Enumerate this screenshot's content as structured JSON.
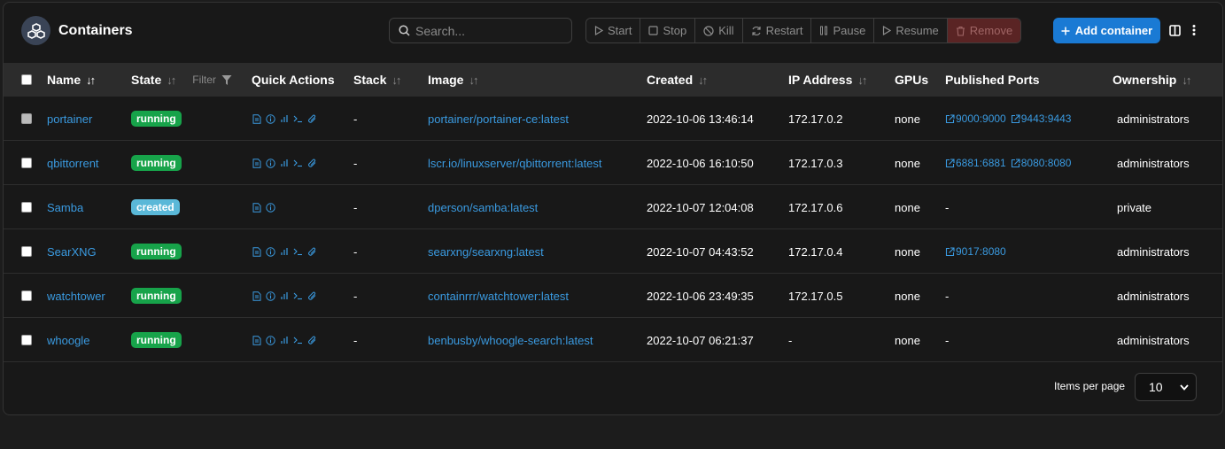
{
  "header": {
    "title": "Containers",
    "search_placeholder": "Search...",
    "actions": {
      "start": "Start",
      "stop": "Stop",
      "kill": "Kill",
      "restart": "Restart",
      "pause": "Pause",
      "resume": "Resume",
      "remove": "Remove"
    },
    "add_container": "Add container"
  },
  "table": {
    "columns": {
      "name": "Name",
      "state": "State",
      "filter": "Filter",
      "quick_actions": "Quick Actions",
      "stack": "Stack",
      "image": "Image",
      "created": "Created",
      "ip": "IP Address",
      "gpus": "GPUs",
      "ports": "Published Ports",
      "ownership": "Ownership"
    },
    "rows": [
      {
        "name": "portainer",
        "state": "running",
        "stack": "-",
        "image": "portainer/portainer-ce:latest",
        "created": "2022-10-06 13:46:14",
        "ip": "172.17.0.2",
        "gpus": "none",
        "port1": "9000:9000",
        "port2": "9443:9443",
        "ports_text": "",
        "ownership": "administrators"
      },
      {
        "name": "qbittorrent",
        "state": "running",
        "stack": "-",
        "image": "lscr.io/linuxserver/qbittorrent:latest",
        "created": "2022-10-06 16:10:50",
        "ip": "172.17.0.3",
        "gpus": "none",
        "port1": "6881:6881",
        "port2": "8080:8080",
        "ports_text": "",
        "ownership": "administrators"
      },
      {
        "name": "Samba",
        "state": "created",
        "stack": "-",
        "image": "dperson/samba:latest",
        "created": "2022-10-07 12:04:08",
        "ip": "172.17.0.6",
        "gpus": "none",
        "port1": "",
        "port2": "",
        "ports_text": "-",
        "ownership": "private"
      },
      {
        "name": "SearXNG",
        "state": "running",
        "stack": "-",
        "image": "searxng/searxng:latest",
        "created": "2022-10-07 04:43:52",
        "ip": "172.17.0.4",
        "gpus": "none",
        "port1": "9017:8080",
        "port2": "",
        "ports_text": "",
        "ownership": "administrators"
      },
      {
        "name": "watchtower",
        "state": "running",
        "stack": "-",
        "image": "containrrr/watchtower:latest",
        "created": "2022-10-06 23:49:35",
        "ip": "172.17.0.5",
        "gpus": "none",
        "port1": "",
        "port2": "",
        "ports_text": "-",
        "ownership": "administrators"
      },
      {
        "name": "whoogle",
        "state": "running",
        "stack": "-",
        "image": "benbusby/whoogle-search:latest",
        "created": "2022-10-07 06:21:37",
        "ip": "-",
        "gpus": "none",
        "port1": "",
        "port2": "",
        "ports_text": "-",
        "ownership": "administrators"
      }
    ]
  },
  "footer": {
    "items_per_page_label": "Items per page",
    "items_per_page_value": "10"
  },
  "colors": {
    "accent": "#1a7ad4",
    "link": "#3a9ae0",
    "running": "#17a34a",
    "created": "#5ab8d8",
    "remove": "#5a2424"
  }
}
